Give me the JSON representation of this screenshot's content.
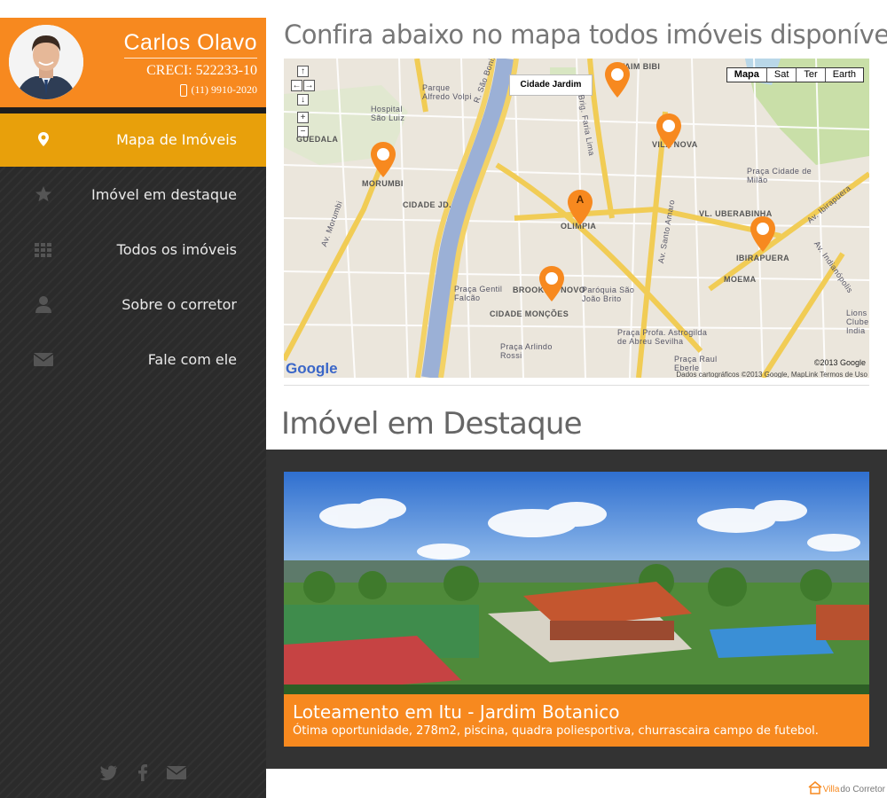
{
  "profile": {
    "name": "Carlos Olavo",
    "creci": "CRECI: 522233-10",
    "phone": "(11) 9910-2020"
  },
  "nav": [
    {
      "label": "Mapa de Imóveis",
      "icon": "map-marker-icon",
      "active": true
    },
    {
      "label": "Imóvel em destaque",
      "icon": "star-icon",
      "active": false
    },
    {
      "label": "Todos os imóveis",
      "icon": "grid-icon",
      "active": false
    },
    {
      "label": "Sobre o corretor",
      "icon": "user-icon",
      "active": false
    },
    {
      "label": "Fale com ele",
      "icon": "envelope-icon",
      "active": false
    }
  ],
  "social": [
    "twitter-icon",
    "facebook-icon",
    "envelope-icon"
  ],
  "map_section": {
    "heading": "Confira abaixo no mapa todos imóveis disponíveis",
    "map_types": [
      "Mapa",
      "Sat",
      "Ter",
      "Earth"
    ],
    "tooltip": "Cidade Jardim",
    "marker_A": "A",
    "labels": {
      "morumbi": "MORUMBI",
      "olimpia": "OLIMPIA",
      "vila_nova": "VILA NOVA",
      "itaim_bibi": "ITAIM BIBI",
      "ibirapuera": "IBIRAPUERA",
      "moema": "MOEMA",
      "brooklin": "BROOKLIN NOVO",
      "vl_uberabinha": "VL. UBERABINHA",
      "cidade_moncoes": "CIDADE MONÇÕES",
      "cidade_jd": "CIDADE JD.",
      "guedala": "GUEDALA",
      "praca_gentil": "Praça Gentil Falcão",
      "praca_arlindo": "Praça Arlindo Rossi",
      "praca_astrogilda": "Praça Profa. Astrogilda de Abreu Sevilha",
      "paroquia": "Paróquia São João Brito",
      "praca_milao": "Praça Cidade de Milão",
      "hospital": "Hospital São Luiz",
      "parque": "Parque Alfredo Volpi",
      "av_sao_bonifacio": "R. São Bonifácio",
      "av_faria_lima": "Brig. Faria Lima",
      "av_santo_amaro": "Av. Santo Amaro",
      "av_ibirapuera": "Av. Ibirapuera",
      "av_indianopolis": "Av. Indianópolis",
      "av_morumbi": "Av. Morumbi",
      "lions": "Lions Clube India",
      "praca_raul": "Praça Raul Eberle"
    },
    "google": "Google",
    "copyright": "©2013 Google",
    "terms": "Dados cartográficos ©2013 Google, MapLink   Termos de Uso"
  },
  "featured_section": {
    "heading": "Imóvel em Destaque",
    "title": "Loteamento em Itu - Jardim Botanico",
    "description": "Ótima oportunidade, 278m2, piscina, quadra poliesportiva, churrascaira campo de futebol."
  },
  "footer": {
    "brand_a": "Villa",
    "brand_b": "do Corretor"
  },
  "colors": {
    "accent_orange": "#f7891f",
    "nav_active": "#e8a00b",
    "sidebar_bg": "#2b2b2b"
  }
}
